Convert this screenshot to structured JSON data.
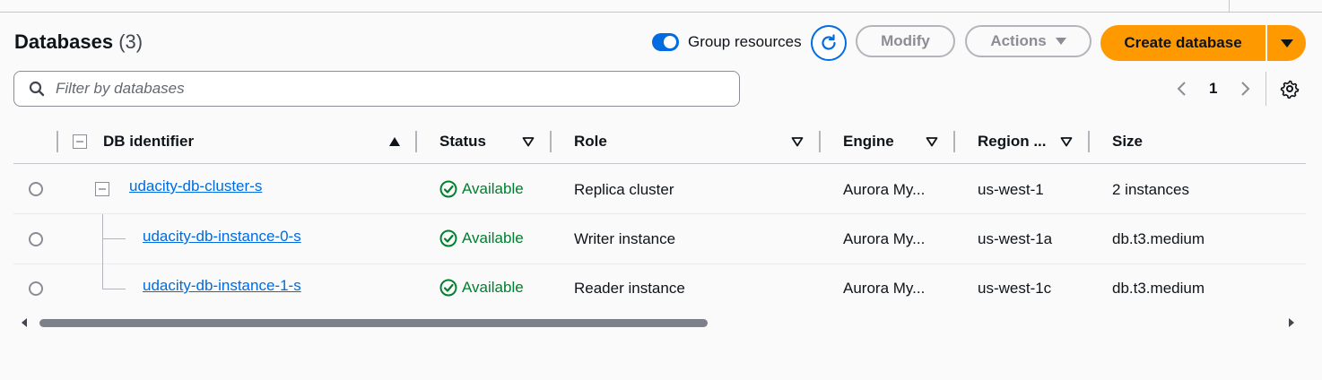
{
  "header": {
    "title": "Databases",
    "count": "(3)",
    "group_resources_label": "Group resources",
    "group_resources_enabled": true,
    "modify_label": "Modify",
    "actions_label": "Actions",
    "create_label": "Create database"
  },
  "search": {
    "placeholder": "Filter by databases",
    "value": ""
  },
  "pagination": {
    "current_page": "1"
  },
  "columns": {
    "db_identifier": "DB identifier",
    "status": "Status",
    "role": "Role",
    "engine": "Engine",
    "region": "Region ...",
    "size": "Size"
  },
  "rows": [
    {
      "identifier": "udacity-db-cluster-s",
      "status": "Available",
      "role": "Replica cluster",
      "engine": "Aurora My...",
      "region": "us-west-1",
      "size": "2 instances"
    },
    {
      "identifier": "udacity-db-instance-0-s",
      "status": "Available",
      "role": "Writer instance",
      "engine": "Aurora My...",
      "region": "us-west-1a",
      "size": "db.t3.medium"
    },
    {
      "identifier": "udacity-db-instance-1-s",
      "status": "Available",
      "role": "Reader instance",
      "engine": "Aurora My...",
      "region": "us-west-1c",
      "size": "db.t3.medium"
    }
  ],
  "scroll": {
    "horizontal_fraction": 0.52
  },
  "colors": {
    "accent": "#006ce0",
    "primary_button": "#ff9900",
    "status_available": "#00802f"
  }
}
